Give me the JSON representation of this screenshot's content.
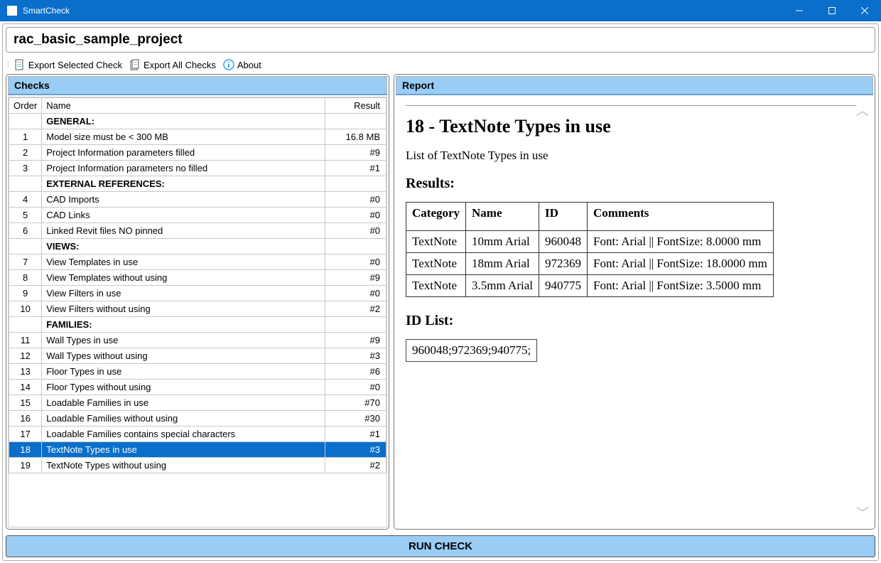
{
  "window": {
    "title": "SmartCheck"
  },
  "project_title": "rac_basic_sample_project",
  "toolbar": {
    "export_selected": "Export Selected Check",
    "export_all": "Export All Checks",
    "about": "About"
  },
  "panels": {
    "checks_title": "Checks",
    "report_title": "Report"
  },
  "checks_headers": {
    "order": "Order",
    "name": "Name",
    "result": "Result"
  },
  "checks_rows": [
    {
      "order": "",
      "name": "GENERAL:",
      "result": "",
      "section": true
    },
    {
      "order": "1",
      "name": "Model size must be < 300 MB",
      "result": "16.8 MB"
    },
    {
      "order": "2",
      "name": "Project Information parameters filled",
      "result": "#9"
    },
    {
      "order": "3",
      "name": "Project Information parameters no filled",
      "result": "#1"
    },
    {
      "order": "",
      "name": "EXTERNAL REFERENCES:",
      "result": "",
      "section": true
    },
    {
      "order": "4",
      "name": "CAD Imports",
      "result": "#0"
    },
    {
      "order": "5",
      "name": "CAD Links",
      "result": "#0"
    },
    {
      "order": "6",
      "name": "Linked Revit files NO pinned",
      "result": "#0"
    },
    {
      "order": "",
      "name": "VIEWS:",
      "result": "",
      "section": true
    },
    {
      "order": "7",
      "name": "View Templates in use",
      "result": "#0"
    },
    {
      "order": "8",
      "name": "View Templates without using",
      "result": "#9"
    },
    {
      "order": "9",
      "name": "View Filters in use",
      "result": "#0"
    },
    {
      "order": "10",
      "name": "View Filters without using",
      "result": "#2"
    },
    {
      "order": "",
      "name": "FAMILIES:",
      "result": "",
      "section": true
    },
    {
      "order": "11",
      "name": "Wall Types in use",
      "result": "#9"
    },
    {
      "order": "12",
      "name": "Wall Types without using",
      "result": "#3"
    },
    {
      "order": "13",
      "name": "Floor Types in use",
      "result": "#6"
    },
    {
      "order": "14",
      "name": "Floor Types without using",
      "result": "#0"
    },
    {
      "order": "15",
      "name": "Loadable Families in use",
      "result": "#70"
    },
    {
      "order": "16",
      "name": "Loadable Families without using",
      "result": "#30"
    },
    {
      "order": "17",
      "name": "Loadable Families contains special characters",
      "result": "#1"
    },
    {
      "order": "18",
      "name": "TextNote Types in use",
      "result": "#3",
      "selected": true
    },
    {
      "order": "19",
      "name": "TextNote Types without using",
      "result": "#2"
    }
  ],
  "report": {
    "heading": "18 - TextNote Types in use",
    "description": "List of TextNote Types in use",
    "results_label": "Results:",
    "table_headers": {
      "category": "Category",
      "name": "Name",
      "id": "ID",
      "comments": "Comments"
    },
    "table_rows": [
      {
        "category": "TextNote",
        "name": "10mm Arial",
        "id": "960048",
        "comments": "Font: Arial || FontSize: 8.0000 mm"
      },
      {
        "category": "TextNote",
        "name": "18mm Arial",
        "id": "972369",
        "comments": "Font: Arial || FontSize: 18.0000 mm"
      },
      {
        "category": "TextNote",
        "name": "3.5mm Arial",
        "id": "940775",
        "comments": "Font: Arial || FontSize: 3.5000 mm"
      }
    ],
    "idlist_label": "ID List:",
    "idlist_value": "960048;972369;940775;"
  },
  "run_button": "RUN CHECK"
}
